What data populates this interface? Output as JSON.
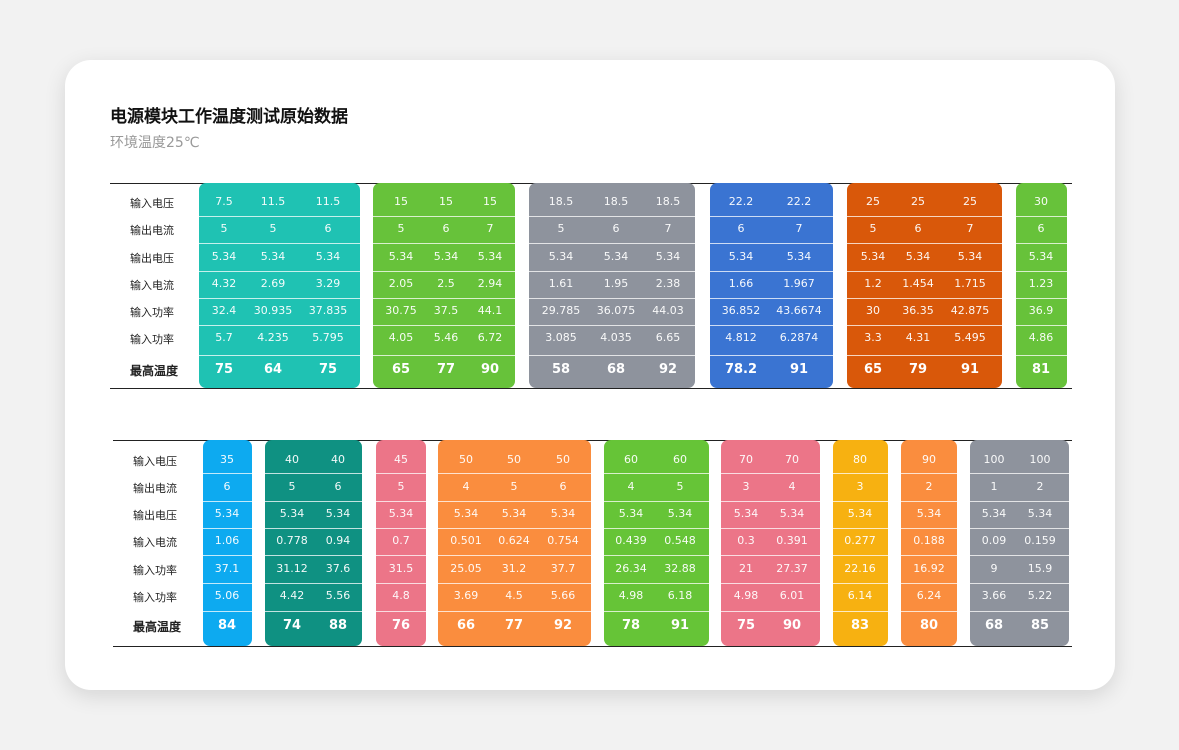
{
  "title": "电源模块工作温度测试原始数据",
  "subtitle": "环境温度25℃",
  "row_labels": {
    "top": [
      "输入电压",
      "输出电流",
      "输出电压",
      "输入电流",
      "输入功率",
      "输入功率",
      "最高温度"
    ],
    "bottom": [
      "输入电压",
      "输出电流",
      "输出电压",
      "输入电流",
      "输入功率",
      "输入功率",
      "最高温度"
    ]
  },
  "colors": {
    "teal": "#1fc2b3",
    "green": "#67c23a",
    "gray": "#8e939d",
    "blue": "#3a74d2",
    "orange_red": "#d9580a",
    "sky": "#0daaf0",
    "dark_teal": "#0f9182",
    "pink": "#ec7588",
    "orange": "#fa8d3e",
    "green2": "#66c437",
    "rose": "#ec7588",
    "amber": "#f7b111",
    "orange_light": "#fa8d3e",
    "gray2": "#8e939d"
  },
  "tables": [
    {
      "groups": [
        {
          "color": "#1fc2b3",
          "columns": [
            [
              "7.5",
              "5",
              "5.34",
              "4.32",
              "32.4",
              "5.7",
              "75"
            ],
            [
              "11.5",
              "5",
              "5.34",
              "2.69",
              "30.935",
              "4.235",
              "64"
            ],
            [
              "11.5",
              "6",
              "5.34",
              "3.29",
              "37.835",
              "5.795",
              "75"
            ]
          ]
        },
        {
          "color": "#67c23a",
          "columns": [
            [
              "15",
              "5",
              "5.34",
              "2.05",
              "30.75",
              "4.05",
              "65"
            ],
            [
              "15",
              "6",
              "5.34",
              "2.5",
              "37.5",
              "5.46",
              "77"
            ],
            [
              "15",
              "7",
              "5.34",
              "2.94",
              "44.1",
              "6.72",
              "90"
            ]
          ]
        },
        {
          "color": "#8e939d",
          "columns": [
            [
              "18.5",
              "5",
              "5.34",
              "1.61",
              "29.785",
              "3.085",
              "58"
            ],
            [
              "18.5",
              "6",
              "5.34",
              "1.95",
              "36.075",
              "4.035",
              "68"
            ],
            [
              "18.5",
              "7",
              "5.34",
              "2.38",
              "44.03",
              "6.65",
              "92"
            ]
          ]
        },
        {
          "color": "#3a74d2",
          "columns": [
            [
              "22.2",
              "6",
              "5.34",
              "1.66",
              "36.852",
              "4.812",
              "78.2"
            ],
            [
              "22.2",
              "7",
              "5.34",
              "1.967",
              "43.6674",
              "6.2874",
              "91"
            ]
          ]
        },
        {
          "color": "#d9580a",
          "columns": [
            [
              "25",
              "5",
              "5.34",
              "1.2",
              "30",
              "3.3",
              "65"
            ],
            [
              "25",
              "6",
              "5.34",
              "1.454",
              "36.35",
              "4.31",
              "79"
            ],
            [
              "25",
              "7",
              "5.34",
              "1.715",
              "42.875",
              "5.495",
              "91"
            ]
          ]
        },
        {
          "color": "#67c23a",
          "columns": [
            [
              "30",
              "6",
              "5.34",
              "1.23",
              "36.9",
              "4.86",
              "81"
            ]
          ]
        }
      ]
    },
    {
      "groups": [
        {
          "color": "#0daaf0",
          "columns": [
            [
              "35",
              "6",
              "5.34",
              "1.06",
              "37.1",
              "5.06",
              "84"
            ]
          ]
        },
        {
          "color": "#0f9182",
          "columns": [
            [
              "40",
              "5",
              "5.34",
              "0.778",
              "31.12",
              "4.42",
              "74"
            ],
            [
              "40",
              "6",
              "5.34",
              "0.94",
              "37.6",
              "5.56",
              "88"
            ]
          ]
        },
        {
          "color": "#ec7588",
          "columns": [
            [
              "45",
              "5",
              "5.34",
              "0.7",
              "31.5",
              "4.8",
              "76"
            ]
          ]
        },
        {
          "color": "#fa8d3e",
          "columns": [
            [
              "50",
              "4",
              "5.34",
              "0.501",
              "25.05",
              "3.69",
              "66"
            ],
            [
              "50",
              "5",
              "5.34",
              "0.624",
              "31.2",
              "4.5",
              "77"
            ],
            [
              "50",
              "6",
              "5.34",
              "0.754",
              "37.7",
              "5.66",
              "92"
            ]
          ]
        },
        {
          "color": "#66c437",
          "columns": [
            [
              "60",
              "4",
              "5.34",
              "0.439",
              "26.34",
              "4.98",
              "78"
            ],
            [
              "60",
              "5",
              "5.34",
              "0.548",
              "32.88",
              "6.18",
              "91"
            ]
          ]
        },
        {
          "color": "#ec7588",
          "columns": [
            [
              "70",
              "3",
              "5.34",
              "0.3",
              "21",
              "4.98",
              "75"
            ],
            [
              "70",
              "4",
              "5.34",
              "0.391",
              "27.37",
              "6.01",
              "90"
            ]
          ]
        },
        {
          "color": "#f7b111",
          "columns": [
            [
              "80",
              "3",
              "5.34",
              "0.277",
              "22.16",
              "6.14",
              "83"
            ]
          ]
        },
        {
          "color": "#fa8d3e",
          "columns": [
            [
              "90",
              "2",
              "5.34",
              "0.188",
              "16.92",
              "6.24",
              "80"
            ]
          ]
        },
        {
          "color": "#8e939d",
          "columns": [
            [
              "100",
              "1",
              "5.34",
              "0.09",
              "9",
              "3.66",
              "68"
            ],
            [
              "100",
              "2",
              "5.34",
              "0.159",
              "15.9",
              "5.22",
              "85"
            ]
          ]
        }
      ]
    }
  ]
}
